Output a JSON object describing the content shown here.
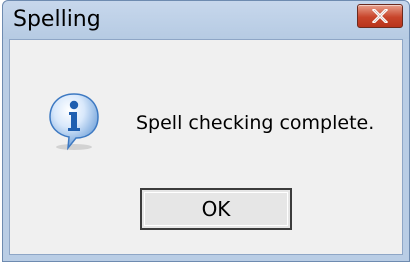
{
  "dialog": {
    "title": "Spelling",
    "message": "Spell checking complete.",
    "ok_label": "OK",
    "icon": "information-icon",
    "close_icon": "close-icon"
  },
  "colors": {
    "titlebar": "#b9cde5",
    "close_button": "#c8452b",
    "client_background": "#f0f0f0",
    "info_icon_blue": "#1f6fc4"
  }
}
